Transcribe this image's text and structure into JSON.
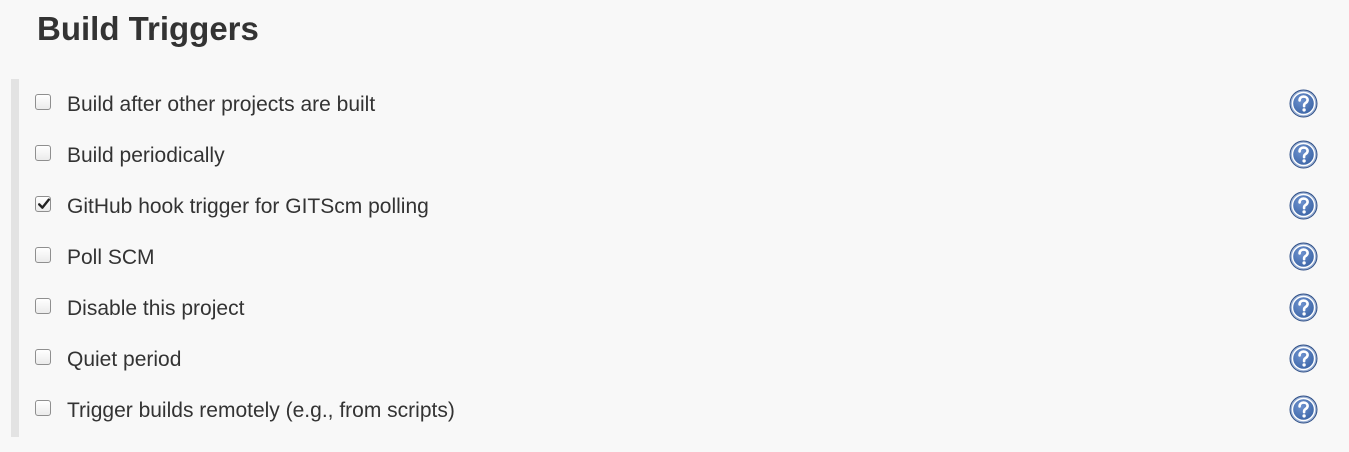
{
  "section": {
    "title": "Build Triggers"
  },
  "options": [
    {
      "label": "Build after other projects are built",
      "checked": false
    },
    {
      "label": "Build periodically",
      "checked": false
    },
    {
      "label": "GitHub hook trigger for GITScm polling",
      "checked": true
    },
    {
      "label": "Poll SCM",
      "checked": false
    },
    {
      "label": "Disable this project",
      "checked": false
    },
    {
      "label": "Quiet period",
      "checked": false
    },
    {
      "label": "Trigger builds remotely (e.g., from scripts)",
      "checked": false
    }
  ],
  "icons": {
    "help": "help-question-icon",
    "check": "checkmark-icon"
  },
  "colors": {
    "background": "#f8f8f8",
    "text": "#333333",
    "rule": "#e3e3e3",
    "help_fill": "#3e67a8",
    "help_ring": "#9ab0d4"
  }
}
